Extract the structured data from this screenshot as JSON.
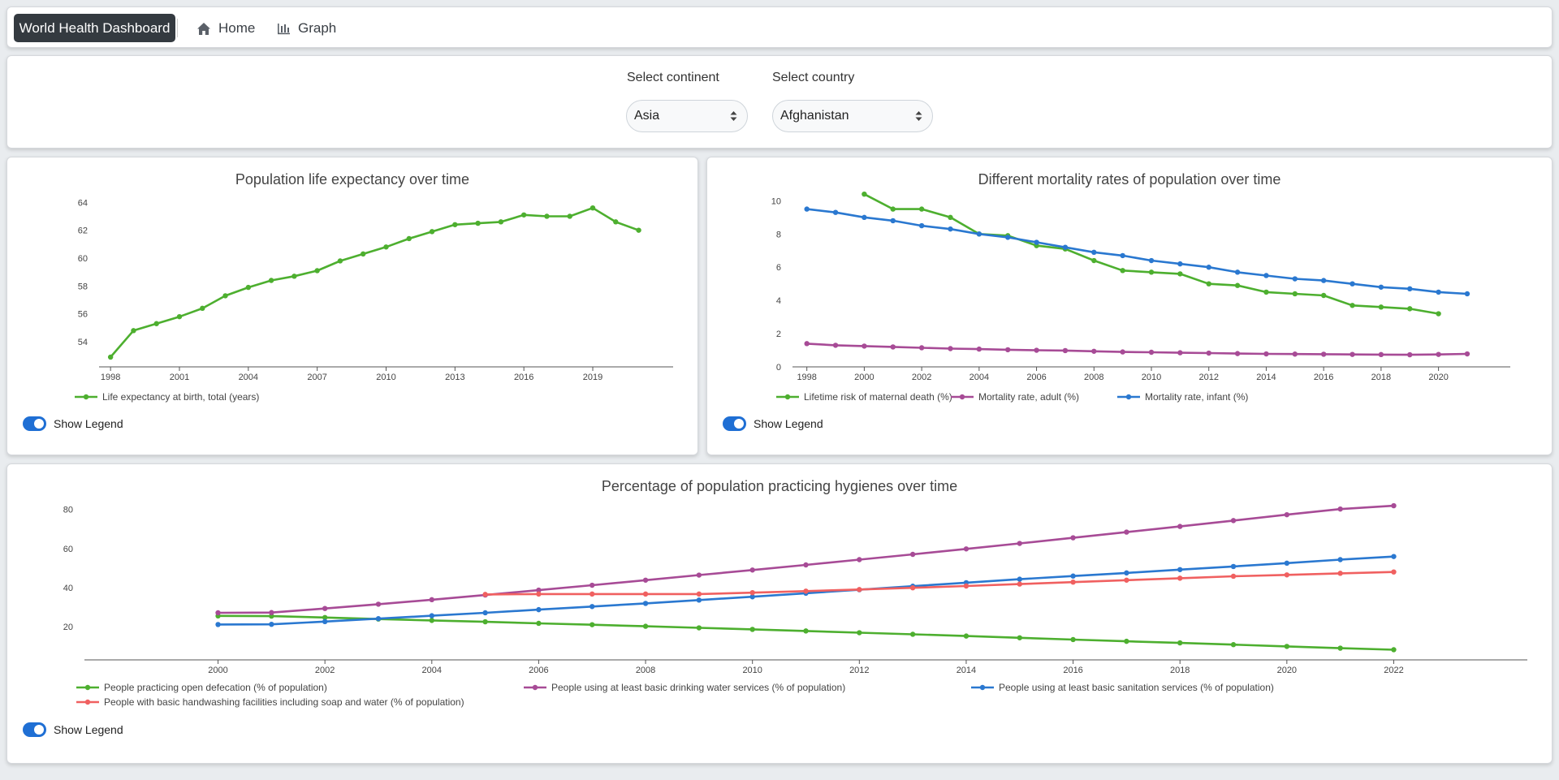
{
  "navbar": {
    "brand": "World Health Dashboard",
    "links": [
      {
        "label": "Home",
        "icon": "home-icon"
      },
      {
        "label": "Graph",
        "icon": "bar-chart-icon"
      }
    ]
  },
  "selector": {
    "continent_label": "Select continent",
    "continent_value": "Asia",
    "country_label": "Select country",
    "country_value": "Afghanistan"
  },
  "toggles": {
    "label": "Show Legend",
    "on": true
  },
  "colors": {
    "green": "#4daf2f",
    "purple": "#a74b96",
    "blue": "#2a78d0",
    "red": "#f06060",
    "accent": "#1f6fd4",
    "brand_bg": "#343a40"
  },
  "chart_data": [
    {
      "type": "line",
      "title": "Population life expectancy over time",
      "xlabel": "",
      "ylabel": "",
      "xticks": [
        "1998",
        "2001",
        "2004",
        "2007",
        "2010",
        "2013",
        "2016",
        "2019"
      ],
      "yticks": [
        "54",
        "56",
        "58",
        "60",
        "62",
        "64"
      ],
      "xlim": [
        1997.5,
        2022.5
      ],
      "ylim": [
        52.2,
        64.6
      ],
      "legend_position": "bottom-left",
      "x": [
        1998,
        1999,
        2000,
        2001,
        2002,
        2003,
        2004,
        2005,
        2006,
        2007,
        2008,
        2009,
        2010,
        2011,
        2012,
        2013,
        2014,
        2015,
        2016,
        2017,
        2018,
        2019,
        2020,
        2021
      ],
      "series": [
        {
          "name": "Life expectancy at birth, total (years)",
          "color": "#4daf2f",
          "values": [
            52.9,
            54.8,
            55.3,
            55.8,
            56.4,
            57.3,
            57.9,
            58.4,
            58.7,
            59.1,
            59.8,
            60.3,
            60.8,
            61.4,
            61.9,
            62.4,
            62.5,
            62.6,
            63.1,
            63.0,
            63.0,
            63.6,
            62.6,
            62.0
          ]
        }
      ]
    },
    {
      "type": "line",
      "title": "Different mortality rates of population over time",
      "xlabel": "",
      "ylabel": "",
      "xticks": [
        "1998",
        "2000",
        "2002",
        "2004",
        "2006",
        "2008",
        "2010",
        "2012",
        "2014",
        "2016",
        "2018",
        "2020"
      ],
      "yticks": [
        "0",
        "2",
        "4",
        "6",
        "8",
        "10"
      ],
      "xlim": [
        1997.5,
        2022.5
      ],
      "ylim": [
        0,
        10.8
      ],
      "legend_position": "bottom-left",
      "x": [
        1998,
        1999,
        2000,
        2001,
        2002,
        2003,
        2004,
        2005,
        2006,
        2007,
        2008,
        2009,
        2010,
        2011,
        2012,
        2013,
        2014,
        2015,
        2016,
        2017,
        2018,
        2019,
        2020,
        2021
      ],
      "series": [
        {
          "name": "Lifetime risk of maternal death (%)",
          "color": "#4daf2f",
          "values": [
            null,
            null,
            10.4,
            9.5,
            9.5,
            9.0,
            8.0,
            7.9,
            7.3,
            7.1,
            6.4,
            5.8,
            5.7,
            5.6,
            5.0,
            4.9,
            4.5,
            4.4,
            4.3,
            3.7,
            3.6,
            3.5,
            3.2,
            null
          ]
        },
        {
          "name": "Mortality rate, adult (%)",
          "color": "#a74b96",
          "values": [
            1.4,
            1.3,
            1.25,
            1.2,
            1.15,
            1.1,
            1.07,
            1.03,
            1.0,
            0.98,
            0.94,
            0.9,
            0.88,
            0.85,
            0.83,
            0.8,
            0.78,
            0.77,
            0.76,
            0.75,
            0.74,
            0.73,
            0.75,
            0.78
          ]
        },
        {
          "name": "Mortality rate, infant (%)",
          "color": "#2a78d0",
          "values": [
            9.5,
            9.3,
            9.0,
            8.8,
            8.5,
            8.3,
            8.0,
            7.8,
            7.5,
            7.2,
            6.9,
            6.7,
            6.4,
            6.2,
            6.0,
            5.7,
            5.5,
            5.3,
            5.2,
            5.0,
            4.8,
            4.7,
            4.5,
            4.4
          ]
        }
      ]
    },
    {
      "type": "line",
      "title": "Percentage of population practicing hygienes over time",
      "xlabel": "",
      "ylabel": "",
      "xticks": [
        "2000",
        "2002",
        "2004",
        "2006",
        "2008",
        "2010",
        "2012",
        "2014",
        "2016",
        "2018",
        "2020",
        "2022"
      ],
      "yticks": [
        "20",
        "40",
        "60",
        "80"
      ],
      "xlim": [
        1997.5,
        2024.5
      ],
      "ylim": [
        3,
        86.5
      ],
      "legend_position": "bottom-left",
      "x": [
        2000,
        2001,
        2002,
        2003,
        2004,
        2005,
        2006,
        2007,
        2008,
        2009,
        2010,
        2011,
        2012,
        2013,
        2014,
        2015,
        2016,
        2017,
        2018,
        2019,
        2020,
        2021,
        2022
      ],
      "series": [
        {
          "name": "People practicing open defecation (% of population)",
          "color": "#4daf2f",
          "values": [
            25.5,
            25.4,
            24.7,
            23.9,
            23.2,
            22.5,
            21.7,
            21.0,
            20.2,
            19.4,
            18.6,
            17.8,
            16.9,
            16.1,
            15.2,
            14.3,
            13.4,
            12.5,
            11.7,
            10.8,
            9.9,
            9.0,
            8.2
          ]
        },
        {
          "name": "People using at least basic drinking water services (% of population)",
          "color": "#a74b96",
          "values": [
            27.1,
            27.2,
            29.3,
            31.5,
            33.8,
            36.2,
            38.7,
            41.2,
            43.8,
            46.4,
            49.0,
            51.6,
            54.3,
            57.0,
            59.8,
            62.6,
            65.5,
            68.4,
            71.3,
            74.3,
            77.3,
            80.2,
            81.9
          ]
        },
        {
          "name": "People using at least basic sanitation services (% of population)",
          "color": "#2a78d0",
          "values": [
            21.1,
            21.2,
            22.6,
            24.1,
            25.6,
            27.1,
            28.7,
            30.3,
            31.9,
            33.6,
            35.3,
            37.1,
            38.9,
            40.7,
            42.5,
            44.3,
            45.9,
            47.5,
            49.2,
            50.8,
            52.5,
            54.3,
            55.9
          ]
        },
        {
          "name": "People with basic handwashing facilities including soap and water (% of population)",
          "color": "#f06060",
          "values": [
            null,
            null,
            null,
            null,
            null,
            36.5,
            36.7,
            36.7,
            36.7,
            36.7,
            37.4,
            38.2,
            39.0,
            39.9,
            40.8,
            41.8,
            42.8,
            43.8,
            44.8,
            45.8,
            46.5,
            47.3,
            48.0
          ]
        }
      ]
    }
  ]
}
